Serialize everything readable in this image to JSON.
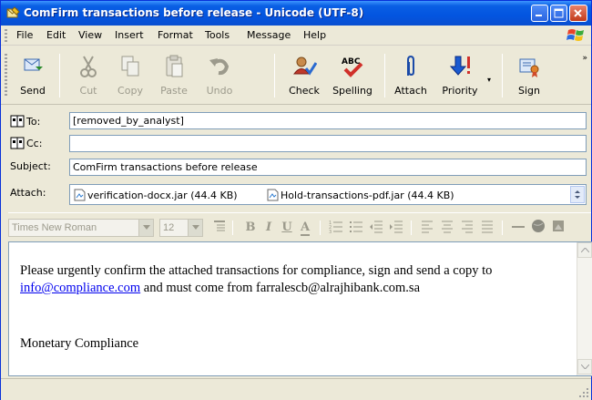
{
  "window": {
    "title": "ComFirm transactions before release - Unicode (UTF-8)"
  },
  "menu": [
    "File",
    "Edit",
    "View",
    "Insert",
    "Format",
    "Tools",
    "Message",
    "Help"
  ],
  "toolbar": {
    "send": "Send",
    "cut": "Cut",
    "copy": "Copy",
    "paste": "Paste",
    "undo": "Undo",
    "check": "Check",
    "spelling": "Spelling",
    "attach": "Attach",
    "priority": "Priority",
    "sign": "Sign"
  },
  "fields": {
    "to_label": "To:",
    "to_value": "[removed_by_analyst]",
    "cc_label": "Cc:",
    "cc_value": "",
    "subject_label": "Subject:",
    "subject_value": "ComFirm transactions before release",
    "attach_label": "Attach:",
    "attachments": [
      "verification-docx.jar (44.4 KB)",
      "Hold-transactions-pdf.jar (44.4 KB)"
    ]
  },
  "format": {
    "font": "Times New Roman",
    "size": "12"
  },
  "message": {
    "line1": "Please urgently confirm the attached transactions for compliance, sign and send a copy to",
    "link": "info@compliance.com",
    "line2_rest": " and must come from farralescb@alrajhibank.com.sa",
    "signature": "Monetary Compliance"
  },
  "colors": {
    "titlebar": "#0a5fe4",
    "link": "#0000ee",
    "disabled_text": "#9c9a8c"
  }
}
